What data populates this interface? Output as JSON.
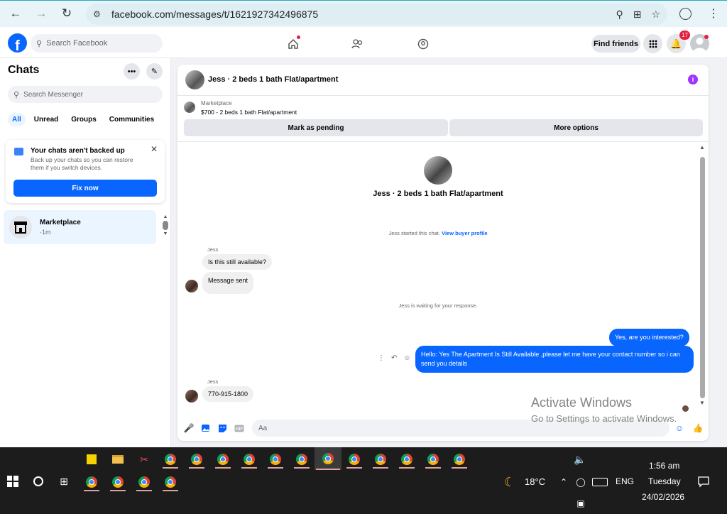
{
  "browser": {
    "url": "facebook.com/messages/t/1621927342496875"
  },
  "facebook": {
    "search_placeholder": "Search Facebook",
    "find_friends": "Find friends",
    "notification_count": "17"
  },
  "sidebar": {
    "title": "Chats",
    "search_placeholder": "Search Messenger",
    "filters": [
      "All",
      "Unread",
      "Groups",
      "Communities"
    ],
    "backup": {
      "title": "Your chats aren't backed up",
      "body": "Back up your chats so you can restore them if you switch devices.",
      "button": "Fix now"
    },
    "chat_item": {
      "name": "Marketplace",
      "time": "·1m"
    }
  },
  "chat": {
    "title": "Jess · 2 beds 1 bath Flat/apartment",
    "marketplace_label": "Marketplace",
    "listing": "$700 - 2 beds 1 bath Flat/apartment",
    "mark_pending": "Mark as pending",
    "more_options": "More options",
    "intro_title": "Jess · 2 beds 1 bath Flat/apartment",
    "started_text": "Jess started this chat.",
    "view_profile": "View buyer profile",
    "sender_1": "Jess",
    "msg_in_1": "Is this still available?",
    "msg_in_2": "Message sent",
    "waiting_text": "Jess is waiting for your response.",
    "msg_out_1": "Yes, are you interested?",
    "msg_out_2": "Hello: Yes The Apartment Is Still Available ,please let me have your contact number so i can send you details",
    "sender_2": "Jess",
    "msg_in_3": "770-915-1800",
    "composer_placeholder": "Aa"
  },
  "watermark": {
    "line1": "Activate Windows",
    "line2": "Go to Settings to activate Windows."
  },
  "taskbar": {
    "temperature": "18°C",
    "language": "ENG",
    "time": "1:56 am",
    "day": "Tuesday",
    "date": "24/02/2026"
  },
  "colors": {
    "brand_blue": "#0866ff",
    "badge_red": "#e41e3f",
    "taskbar": "#1c1c1c"
  }
}
